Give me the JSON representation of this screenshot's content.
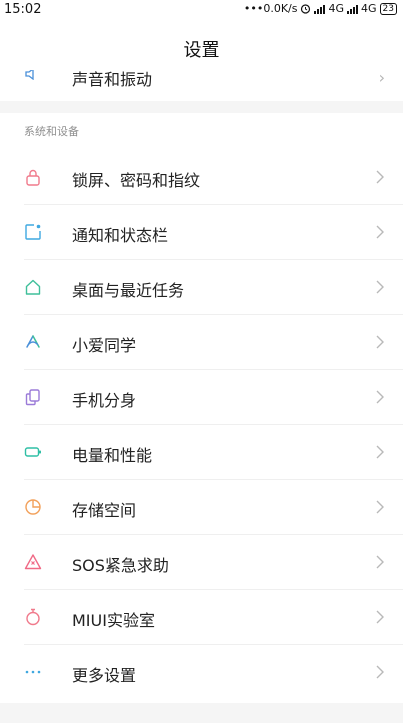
{
  "status_bar": {
    "time": "15:02",
    "network_speed": "•••0.0K/s",
    "alarm_icon": "alarm-icon",
    "sim1": "4G",
    "sim2": "4G",
    "battery": "23"
  },
  "header": {
    "title": "设置"
  },
  "partial_row": {
    "label": "声音和振动"
  },
  "section": {
    "title": "系统和设备",
    "items": [
      {
        "label": "锁屏、密码和指纹",
        "icon": "lock-icon",
        "color": "#f07a8c"
      },
      {
        "label": "通知和状态栏",
        "icon": "notification-icon",
        "color": "#3fa8e0"
      },
      {
        "label": "桌面与最近任务",
        "icon": "home-icon",
        "color": "#3fbf9a"
      },
      {
        "label": "小爱同学",
        "icon": "xiaoai-icon",
        "color": "#4a90d9"
      },
      {
        "label": "手机分身",
        "icon": "second-space-icon",
        "color": "#9b7bd8"
      },
      {
        "label": "电量和性能",
        "icon": "battery-icon",
        "color": "#2fbfa5"
      },
      {
        "label": "存储空间",
        "icon": "storage-icon",
        "color": "#f2a05a"
      },
      {
        "label": "SOS紧急求助",
        "icon": "sos-icon",
        "color": "#f06a86"
      },
      {
        "label": "MIUI实验室",
        "icon": "lab-icon",
        "color": "#f07a8c"
      },
      {
        "label": "更多设置",
        "icon": "more-icon",
        "color": "#3fa8e0"
      }
    ]
  }
}
